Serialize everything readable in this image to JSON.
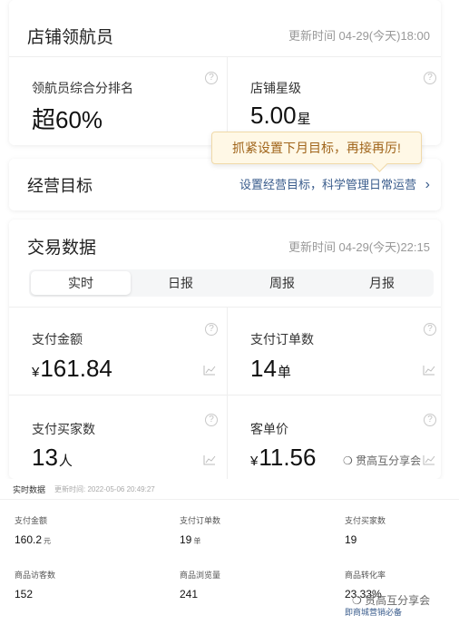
{
  "leader": {
    "title": "店铺领航员",
    "update_time": "更新时间 04-29(今天)18:00",
    "rank_label": "领航员综合分排名",
    "rank_value": "超60%",
    "star_label": "店铺星级",
    "star_value": "5.00",
    "star_unit": "星"
  },
  "tooltip": {
    "text": "抓紧设置下月目标，再接再厉!"
  },
  "goal": {
    "title": "经营目标",
    "link": "设置经营目标，科学管理日常运营",
    "link_arrow": "›"
  },
  "trade": {
    "title": "交易数据",
    "update_time": "更新时间 04-29(今天)22:15",
    "tabs": [
      "实时",
      "日报",
      "周报",
      "月报"
    ],
    "active_tab": 0,
    "metrics": [
      {
        "label": "支付金额",
        "prefix": "¥",
        "value": "161.84",
        "unit": ""
      },
      {
        "label": "支付订单数",
        "prefix": "",
        "value": "14",
        "unit": "单"
      },
      {
        "label": "支付买家数",
        "prefix": "",
        "value": "13",
        "unit": "人"
      },
      {
        "label": "客单价",
        "prefix": "¥",
        "value": "11.56",
        "unit": ""
      }
    ],
    "help_glyph": "?",
    "watermark": "贯高互分享会"
  },
  "realtime": {
    "title": "实时数据",
    "time": "更新时间: 2022-05-06 20:49:27",
    "items": [
      {
        "label": "支付金额",
        "value": "160.2",
        "unit": "元"
      },
      {
        "label": "支付订单数",
        "value": "19",
        "unit": "单"
      },
      {
        "label": "支付买家数",
        "value": "19",
        "unit": ""
      },
      {
        "label": "商品访客数",
        "value": "152",
        "unit": ""
      },
      {
        "label": "商品浏览量",
        "value": "241",
        "unit": ""
      },
      {
        "label": "商品转化率",
        "value": "23.33%",
        "unit": ""
      }
    ],
    "watermark": "贯高互分享会",
    "watermark_sub": "即商城营销必备"
  },
  "colors": {
    "tooltip_bg": "#fff8e6",
    "tooltip_text": "#a0651b",
    "link": "#3a5c8c"
  }
}
